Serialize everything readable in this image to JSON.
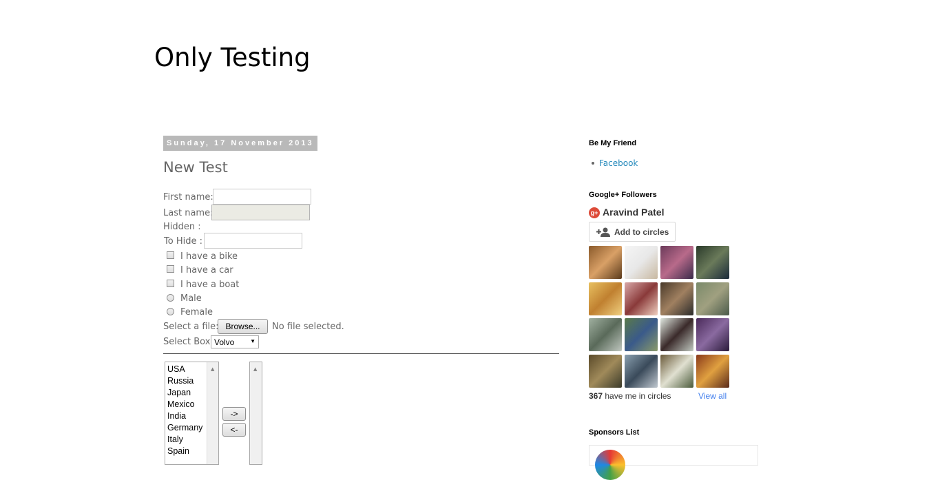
{
  "blog": {
    "title": "Only Testing"
  },
  "post": {
    "date": "Sunday, 17 November 2013",
    "title": "New Test",
    "form": {
      "first_name_label": "First name:",
      "last_name_label": "Last name:",
      "hidden_label": "Hidden :",
      "to_hide_label": "To Hide :",
      "checkboxes": [
        "I have a bike",
        "I have a car",
        "I have a boat"
      ],
      "radios": [
        "Male",
        "Female"
      ],
      "file_label": "Select a file:",
      "browse_label": "Browse...",
      "no_file_text": "No file selected.",
      "select_label": "Select Box:",
      "select_value": "Volvo",
      "countries": [
        "USA",
        "Russia",
        "Japan",
        "Mexico",
        "India",
        "Germany",
        "Italy",
        "Spain"
      ],
      "move_right_label": "->",
      "move_left_label": "<-"
    }
  },
  "sidebar": {
    "friend_title": "Be My Friend",
    "friend_link": "Facebook",
    "gplus_title": "Google+ Followers",
    "gplus_icon": "g+",
    "gplus_name": "Aravind Patel",
    "add_to_circles": "Add to circles",
    "circles_count": "367",
    "circles_text": "have me in circles",
    "view_all": "View all",
    "sponsors_title": "Sponsors List"
  },
  "colors": {
    "link": "#2288bb",
    "gplus": "#dd4b39",
    "date_bg": "#b9b9b9",
    "view_all": "#427fed"
  }
}
